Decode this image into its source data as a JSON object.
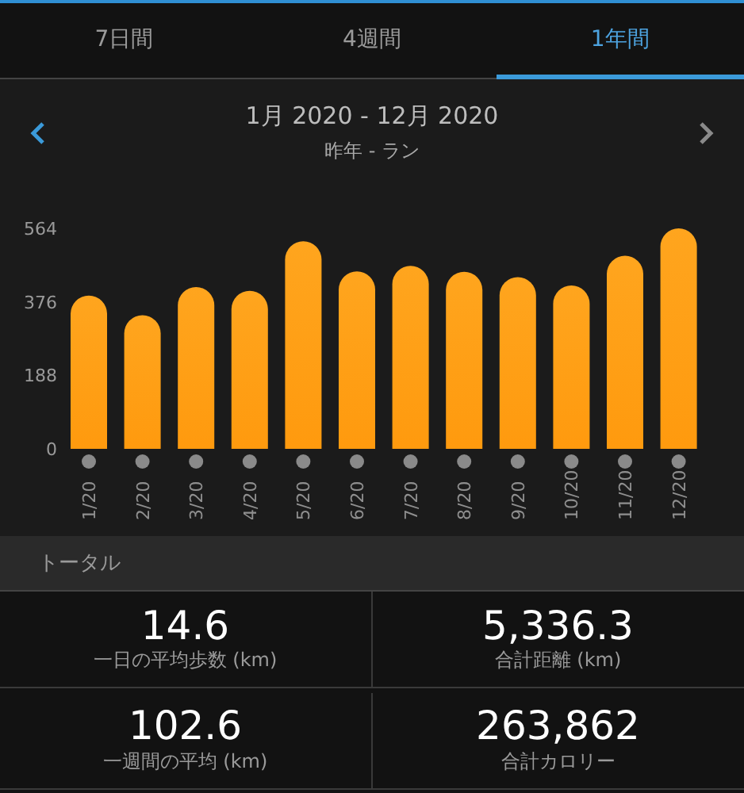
{
  "tabs": [
    {
      "label": "7日間",
      "selected": false
    },
    {
      "label": "4週間",
      "selected": false
    },
    {
      "label": "1年間",
      "selected": true
    }
  ],
  "period": {
    "range": "1月 2020 - 12月 2020",
    "subtitle": "昨年 - ラン",
    "prev_enabled": true,
    "next_enabled": false
  },
  "chart_data": {
    "type": "bar",
    "categories": [
      "1/20",
      "2/20",
      "3/20",
      "4/20",
      "5/20",
      "6/20",
      "7/20",
      "8/20",
      "9/20",
      "10/20",
      "11/20",
      "12/20"
    ],
    "series": [
      {
        "color": "#ff9a0e",
        "values": [
          392,
          342,
          414,
          404,
          531,
          454,
          468,
          453,
          439,
          418,
          494,
          564
        ]
      }
    ],
    "ylim": [
      0,
      564
    ],
    "yticks": [
      0,
      188,
      376,
      564
    ]
  },
  "totals": {
    "title": "トータル",
    "stats": [
      {
        "value": "14.6",
        "label": "一日の平均歩数 (km)"
      },
      {
        "value": "5,336.3",
        "label": "合計距離 (km)"
      },
      {
        "value": "102.6",
        "label": "一週間の平均 (km)"
      },
      {
        "value": "263,862",
        "label": "合計カロリー"
      }
    ]
  }
}
